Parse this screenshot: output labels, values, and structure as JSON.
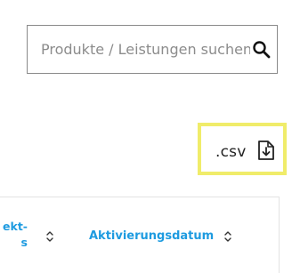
{
  "search": {
    "placeholder": "Produkte / Leistungen suchen"
  },
  "export": {
    "csv_label": ".csv",
    "highlight_color": "#f0ec6a",
    "icon": "file-download-icon"
  },
  "table": {
    "link_color": "#1e9be0",
    "columns": [
      {
        "label_line1": "ekt-",
        "label_line2": "s",
        "sort_icon": "sort-updown-icon"
      },
      {
        "label": "Aktivierungsdatum",
        "sort_icon": "sort-updown-icon"
      }
    ]
  }
}
